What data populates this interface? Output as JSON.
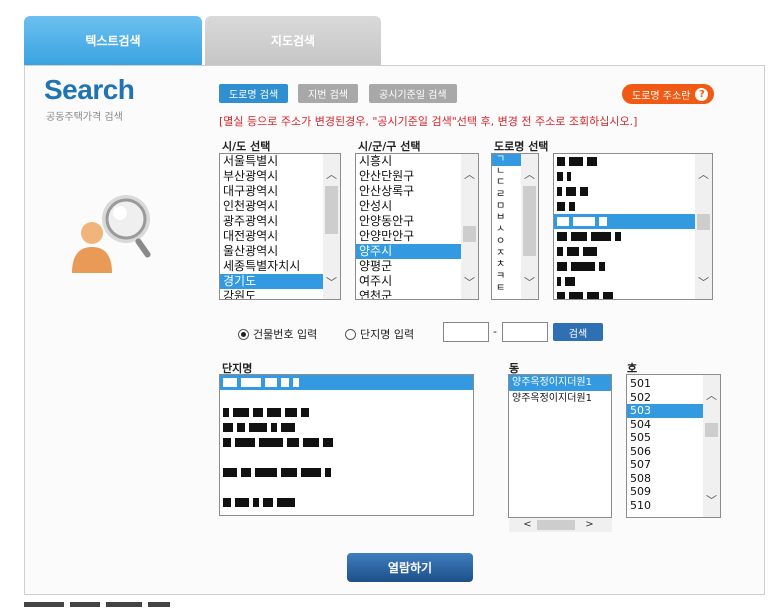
{
  "tabs": [
    {
      "label": "텍스트검색"
    },
    {
      "label": "지도검색"
    }
  ],
  "logo": {
    "title": "Search",
    "subtitle": "공동주택가격 검색"
  },
  "search_types": {
    "road": "도로명 검색",
    "lot": "지번 검색",
    "date": "공시기준일 검색",
    "road_addr_help": "도로명 주소란"
  },
  "notice": "[멸실 등으로 주소가 변경된경우, \"공시기준일 검색\"선택 후, 변경 전 주소로 조회하십시오.]",
  "sido": {
    "label": "시/도 선택",
    "items": [
      "서울특별시",
      "부산광역시",
      "대구광역시",
      "인천광역시",
      "광주광역시",
      "대전광역시",
      "울산광역시",
      "세종특별자치시",
      "경기도",
      "강원도"
    ],
    "selected_index": 8
  },
  "sigungu": {
    "label": "시/군/구 선택",
    "items": [
      "시흥시",
      "안산단원구",
      "안산상록구",
      "안성시",
      "안양동안구",
      "안양만안구",
      "양주시",
      "양평군",
      "여주시",
      "연천군"
    ],
    "selected_index": 6
  },
  "road": {
    "label": "도로명 선택",
    "initials": [
      "ㄱ",
      "ㄴ",
      "ㄷ",
      "ㄹ",
      "ㅁ",
      "ㅂ",
      "ㅅ",
      "ㅇ",
      "ㅈ",
      "ㅊ",
      "ㅋ",
      "ㅌ"
    ],
    "selected_initial": 0,
    "selected_road_row": 4
  },
  "input_mode": {
    "building": "건물번호 입력",
    "complex": "단지명 입력",
    "selected": "building",
    "search_button": "검색",
    "separator": "-"
  },
  "complex": {
    "label": "단지명"
  },
  "dong": {
    "label": "동",
    "items": [
      "양주옥정이지더원1",
      "양주옥정이지더원1"
    ],
    "selected_index": 0
  },
  "ho": {
    "label": "호",
    "items": [
      "501",
      "502",
      "503",
      "504",
      "505",
      "506",
      "507",
      "508",
      "509",
      "510"
    ],
    "selected_index": 2
  },
  "view_button": "열람하기",
  "colors": {
    "tab_active": "#3aa3e0",
    "tab_inactive": "#c6c6c6",
    "accent": "#2f8fd0",
    "help": "#f05a14",
    "notice": "#d6262c",
    "view": "#1d4f8a"
  }
}
